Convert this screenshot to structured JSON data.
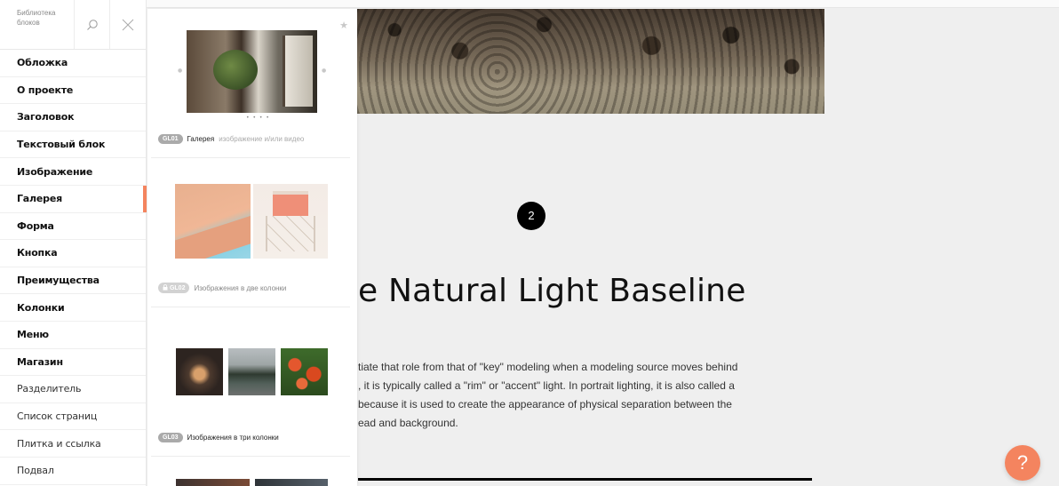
{
  "sidebar": {
    "title": "Библиотека блоков",
    "items": [
      {
        "label": "Обложка",
        "bold": true
      },
      {
        "label": "О проекте",
        "bold": true
      },
      {
        "label": "Заголовок",
        "bold": true
      },
      {
        "label": "Текстовый блок",
        "bold": true
      },
      {
        "label": "Изображение",
        "bold": true
      },
      {
        "label": "Галерея",
        "bold": true,
        "active": true
      },
      {
        "label": "Форма",
        "bold": true
      },
      {
        "label": "Кнопка",
        "bold": true
      },
      {
        "label": "Преимущества",
        "bold": true
      },
      {
        "label": "Колонки",
        "bold": true
      },
      {
        "label": "Меню",
        "bold": true
      },
      {
        "label": "Магазин",
        "bold": true
      },
      {
        "label": "Разделитель",
        "bold": false
      },
      {
        "label": "Список страниц",
        "bold": false
      },
      {
        "label": "Плитка и ссылка",
        "bold": false
      },
      {
        "label": "Подвал",
        "bold": false
      }
    ],
    "icons": {
      "search": "search-icon",
      "close": "close-icon"
    }
  },
  "panel": {
    "star": "★",
    "cards": [
      {
        "code": "GL01",
        "title": "Галерея",
        "subtitle": "изображение и/или видео",
        "pager": "• • • •",
        "locked": false
      },
      {
        "code": "GL02",
        "title": "Изображения в две колонки",
        "subtitle": "",
        "locked": true
      },
      {
        "code": "GL03",
        "title": "Изображения в три колонки",
        "subtitle": "",
        "locked": false
      }
    ]
  },
  "canvas": {
    "number": "2",
    "headline": "e Natural Light Baseline",
    "body_lines": [
      "tiate that role from that of \"key\" modeling when a modeling source moves behind",
      ", it is typically called a \"rim\" or \"accent\" light. In portrait lighting, it is also called a",
      " because it is used to create the appearance of physical separation between the",
      "ead and background."
    ],
    "help": "?"
  },
  "colors": {
    "accent": "#f4845f",
    "badge": "#aaaaaa"
  }
}
